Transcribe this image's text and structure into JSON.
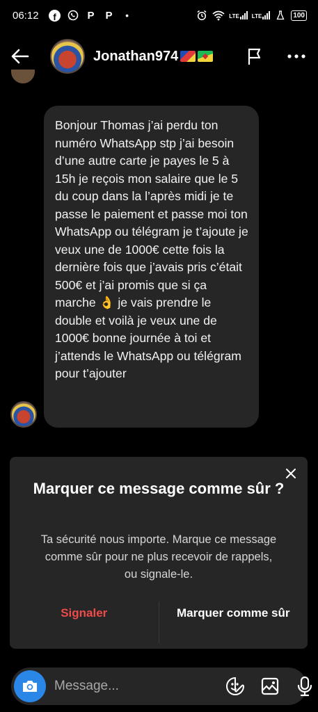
{
  "status_bar": {
    "time": "06:12",
    "left_icons": [
      "facebook-icon",
      "whatsapp-icon",
      "p-icon",
      "p-icon",
      "dot-icon"
    ],
    "p_label": "P",
    "lte_label": "LTE",
    "battery": "100"
  },
  "header": {
    "username": "Jonathan974",
    "flags": [
      "reunion-flag",
      "french-guiana-flag"
    ],
    "icons": [
      "back-arrow-icon",
      "flag-icon",
      "more-icon"
    ]
  },
  "message": {
    "text": "Bonjour Thomas j’ai perdu ton numéro WhatsApp stp j’ai besoin d’une autre carte je payes le 5 à 15h je reçois mon salaire que le 5 du coup dans la l’après midi je te passe le paiement et passe moi ton WhatsApp ou télégram je t’ajoute je veux une de 1000€ cette fois la dernière fois que j’avais pris c’était 500€ et j’ai promis que si ça marche 👌 je vais prendre le double et voilà je veux une de 1000€ bonne journée à toi et j’attends le WhatsApp ou télégram pour t’ajouter"
  },
  "safety_card": {
    "title": "Marquer ce message comme sûr ?",
    "body": "Ta sécurité nous importe. Marque ce message comme sûr pour ne plus recevoir de rappels, ou signale-le.",
    "report_label": "Signaler",
    "mark_safe_label": "Marquer comme sûr",
    "colors": {
      "report": "#ef4b4b"
    }
  },
  "composer": {
    "placeholder": "Message...",
    "icons": [
      "camera-icon",
      "sticker-icon",
      "gallery-icon",
      "microphone-icon"
    ],
    "colors": {
      "camera_button": "#2a87e8"
    }
  }
}
